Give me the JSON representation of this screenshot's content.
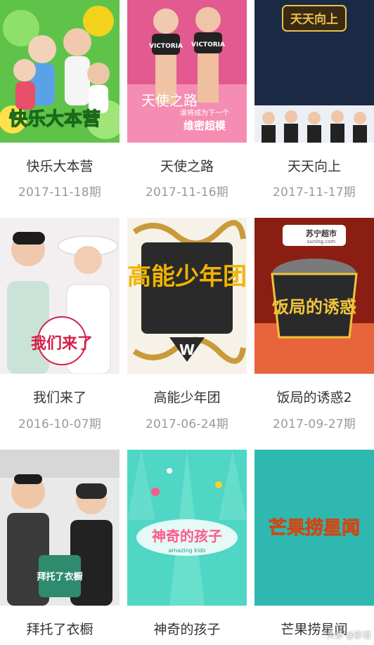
{
  "shows": [
    {
      "title": "快乐大本营",
      "episode": "2017-11-18期",
      "poster_text": "快乐大本营",
      "colors": {
        "bg": "#5fc34a",
        "accent": "#f4d21c"
      }
    },
    {
      "title": "天使之路",
      "episode": "2017-11-16期",
      "poster_text_1": "VICTORIA",
      "poster_text_2": "天使之路",
      "poster_text_3": "谁将成为下一个",
      "poster_text_4": "维密超模",
      "colors": {
        "bg": "#e25a8f",
        "accent": "#ffffff"
      }
    },
    {
      "title": "天天向上",
      "episode": "2017-11-17期",
      "poster_text": "天天向上",
      "colors": {
        "bg": "#1a2a44",
        "accent": "#e9c24a"
      }
    },
    {
      "title": "我们来了",
      "episode": "2016-10-07期",
      "poster_text": "我们来了",
      "colors": {
        "bg": "#f3eff0",
        "accent": "#d51f4a"
      }
    },
    {
      "title": "高能少年团",
      "episode": "2017-06-24期",
      "poster_text": "高能少年团",
      "colors": {
        "bg": "#f6f2e8",
        "accent": "#f0b400"
      }
    },
    {
      "title": "饭局的诱惑2",
      "episode": "2017-09-27期",
      "poster_text_1": "苏宁超市",
      "poster_text_2": "suning.com",
      "poster_text_3": "饭局的诱惑",
      "colors": {
        "bg": "#8b1e12",
        "accent": "#f2c43a"
      }
    },
    {
      "title": "拜托了衣橱",
      "episode": "",
      "poster_text": "拜托了衣橱",
      "colors": {
        "bg": "#e9e9e9",
        "accent": "#2e8b6e"
      }
    },
    {
      "title": "神奇的孩子",
      "episode": "",
      "poster_text_1": "神奇的孩子",
      "poster_text_2": "amazing kids",
      "colors": {
        "bg": "#4fd6c4",
        "accent": "#ff5a8a"
      }
    },
    {
      "title": "芒果捞星闻",
      "episode": "",
      "poster_text": "芒果捞星闻",
      "colors": {
        "bg": "#2fb8b0",
        "accent": "#ffd21f"
      }
    }
  ],
  "watermark": "头条 @影看"
}
